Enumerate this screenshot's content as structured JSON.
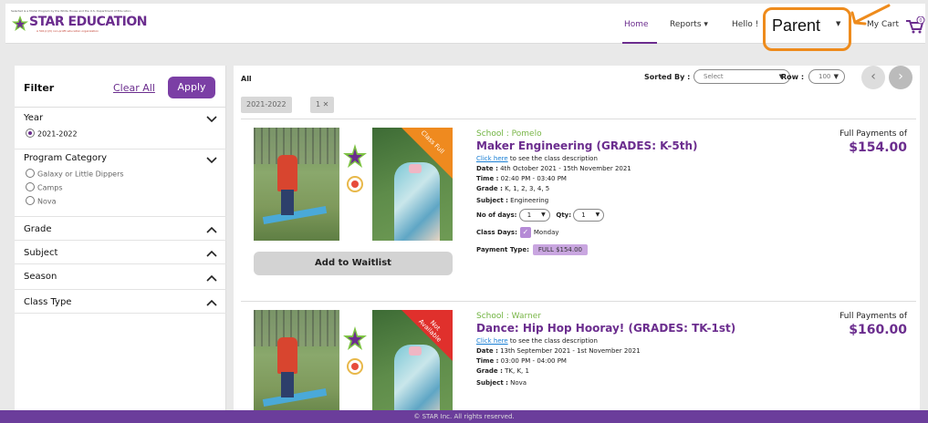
{
  "header": {
    "logo_tagline": "Selected is a Model Program by the White House and the U.S. Department of Education",
    "logo_brand": "STAR EDUCATION",
    "logo_sub": "A 501(c)(3) non-profit education organization",
    "nav_home": "Home",
    "nav_reports": "Reports",
    "nav_hello": "Hello !",
    "parent_label": "Parent",
    "nav_cart": "My Cart",
    "cart_count": "0",
    "accent_color": "#6b2d8e",
    "annotation_color": "#ee8b1c"
  },
  "filter": {
    "title": "Filter",
    "clear_all": "Clear All",
    "apply": "Apply",
    "year_label": "Year",
    "year_option": "2021-2022",
    "program_category_label": "Program Category",
    "program_options": [
      "Galaxy or Little Dippers",
      "Camps",
      "Nova"
    ],
    "grade_label": "Grade",
    "subject_label": "Subject",
    "season_label": "Season",
    "class_type_label": "Class Type"
  },
  "toolbar": {
    "all_label": "All",
    "chip_year": "2021-2022",
    "chip_count": "1",
    "sorted_by_label": "Sorted By :",
    "sorted_by_value": "Select",
    "row_label": "Row :",
    "row_value": "100"
  },
  "cards": [
    {
      "ribbon": "Class Full",
      "button": "Add to Waitlist",
      "school_label": "School :",
      "school": "Pomelo",
      "name": "Maker Engineering (GRADES: K-5th)",
      "click_here": "Click here",
      "click_tail": " to see the class description",
      "date_label": "Date :",
      "date": " 4th October 2021 - 15th November 2021",
      "time_label": "Time :",
      "time": " 02:40 PM - 03:40 PM",
      "grade_label": "Grade :",
      "grade": " K, 1, 2, 3, 4, 5",
      "subject_label": "Subject :",
      "subject": " Engineering",
      "days_label": "No of days:",
      "days_value": "1",
      "qty_label": "Qty:",
      "qty_value": "1",
      "class_days_label": "Class Days:",
      "class_days": "Monday",
      "payment_type_label": "Payment Type:",
      "payment_type": "FULL  $154.00",
      "price_label": "Full Payments of",
      "price": "$154.00"
    },
    {
      "ribbon": "Not Available",
      "school_label": "School :",
      "school": "Warner",
      "name": "Dance: Hip Hop Hooray! (GRADES: TK-1st)",
      "click_here": "Click here",
      "click_tail": " to see the class description",
      "date_label": "Date :",
      "date": " 13th September 2021 - 1st November 2021",
      "time_label": "Time :",
      "time": " 03:00 PM - 04:00 PM",
      "grade_label": "Grade :",
      "grade": " TK, K, 1",
      "subject_label": "Subject :",
      "subject": " Nova",
      "price_label": "Full Payments of",
      "price": "$160.00"
    }
  ],
  "footer": "© STAR Inc. All rights reserved."
}
